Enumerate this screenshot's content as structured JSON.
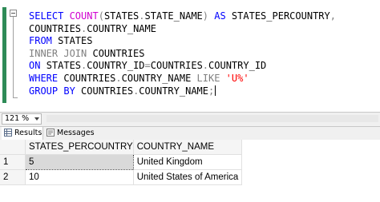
{
  "editor": {
    "lines": [
      [
        {
          "t": "SELECT ",
          "c": "kw"
        },
        {
          "t": "COUNT",
          "c": "fn"
        },
        {
          "t": "(",
          "c": "op"
        },
        {
          "t": "STATES",
          "c": ""
        },
        {
          "t": ".",
          "c": "op"
        },
        {
          "t": "STATE_NAME",
          "c": ""
        },
        {
          "t": ")",
          "c": "op"
        },
        {
          "t": " AS ",
          "c": "kw"
        },
        {
          "t": "STATES_PERCOUNTRY",
          "c": ""
        },
        {
          "t": ",",
          "c": "op"
        }
      ],
      [
        {
          "t": "COUNTRIES",
          "c": ""
        },
        {
          "t": ".",
          "c": "op"
        },
        {
          "t": "COUNTRY_NAME",
          "c": ""
        }
      ],
      [
        {
          "t": "FROM ",
          "c": "kw"
        },
        {
          "t": "STATES",
          "c": ""
        }
      ],
      [
        {
          "t": "INNER JOIN ",
          "c": "op"
        },
        {
          "t": "COUNTRIES",
          "c": ""
        }
      ],
      [
        {
          "t": "ON ",
          "c": "kw"
        },
        {
          "t": "STATES",
          "c": ""
        },
        {
          "t": ".",
          "c": "op"
        },
        {
          "t": "COUNTRY_ID",
          "c": ""
        },
        {
          "t": "=",
          "c": "op"
        },
        {
          "t": "COUNTRIES",
          "c": ""
        },
        {
          "t": ".",
          "c": "op"
        },
        {
          "t": "COUNTRY_ID",
          "c": ""
        }
      ],
      [
        {
          "t": "WHERE ",
          "c": "kw"
        },
        {
          "t": "COUNTRIES",
          "c": ""
        },
        {
          "t": ".",
          "c": "op"
        },
        {
          "t": "COUNTRY_NAME ",
          "c": ""
        },
        {
          "t": "LIKE ",
          "c": "op"
        },
        {
          "t": "'U%'",
          "c": "str"
        }
      ],
      [
        {
          "t": "GROUP BY ",
          "c": "kw"
        },
        {
          "t": "COUNTRIES",
          "c": ""
        },
        {
          "t": ".",
          "c": "op"
        },
        {
          "t": "COUNTRY_NAME",
          "c": ""
        },
        {
          "t": ";",
          "c": "op"
        }
      ]
    ]
  },
  "zoom": {
    "value": "121 %"
  },
  "tabs": {
    "results_label": "Results",
    "messages_label": "Messages"
  },
  "grid": {
    "columns": [
      "STATES_PERCOUNTRY",
      "COUNTRY_NAME"
    ],
    "rows": [
      {
        "num": "1",
        "cells": [
          "5",
          "United Kingdom"
        ]
      },
      {
        "num": "2",
        "cells": [
          "10",
          "United States of America"
        ]
      }
    ]
  },
  "colors": {
    "keyword": "#0000ff",
    "function": "#d000d0",
    "operator": "#808080",
    "string": "#ff0000",
    "change_bar": "#2e8b57"
  },
  "icons": [
    "collapse-minus-icon",
    "results-grid-icon",
    "messages-icon",
    "dropdown-arrow-icon"
  ]
}
